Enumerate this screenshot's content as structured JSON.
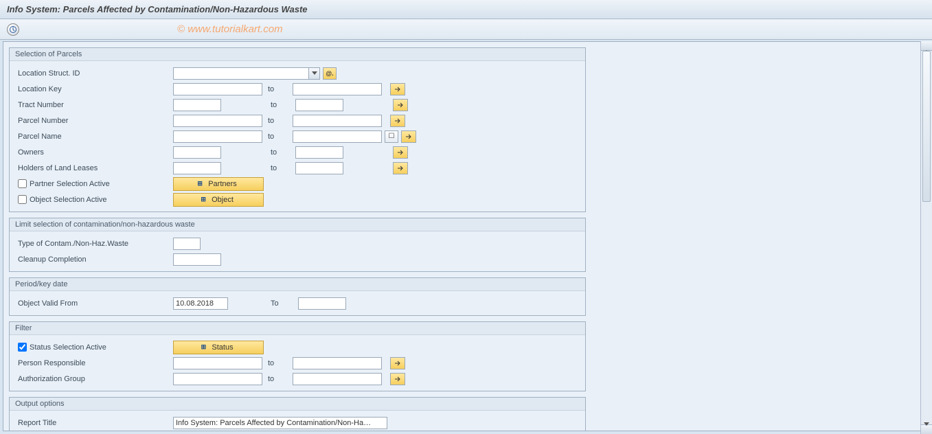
{
  "title": "Info System: Parcels Affected by Contamination/Non-Hazardous Waste",
  "watermark": "© www.tutorialkart.com",
  "labels": {
    "to": "to",
    "To": "To"
  },
  "groups": {
    "parcels": {
      "title": "Selection of Parcels",
      "loc_struct_id": "Location Struct. ID",
      "location_key": "Location Key",
      "tract_number": "Tract Number",
      "parcel_number": "Parcel Number",
      "parcel_name": "Parcel Name",
      "owners": "Owners",
      "holders": "Holders of Land Leases",
      "partner_sel": "Partner Selection Active",
      "object_sel": "Object Selection Active",
      "partners_btn": "Partners",
      "object_btn": "Object"
    },
    "contam": {
      "title": "Limit selection of contamination/non-hazardous waste",
      "type": "Type of Contam./Non-Haz.Waste",
      "cleanup": "Cleanup Completion"
    },
    "period": {
      "title": "Period/key date",
      "valid_from": "Object Valid From",
      "valid_from_value": "10.08.2018"
    },
    "filter": {
      "title": "Filter",
      "status_sel": "Status Selection Active",
      "status_btn": "Status",
      "person_resp": "Person Responsible",
      "auth_group": "Authorization Group"
    },
    "output": {
      "title": "Output options",
      "report_title": "Report Title",
      "report_title_value": "Info System: Parcels Affected by Contamination/Non-Ha…"
    }
  },
  "values": {
    "loc_struct_id": "",
    "location_key_from": "",
    "location_key_to": "",
    "tract_from": "",
    "tract_to": "",
    "parcel_num_from": "",
    "parcel_num_to": "",
    "parcel_name_from": "",
    "parcel_name_to": "",
    "owners_from": "",
    "owners_to": "",
    "holders_from": "",
    "holders_to": "",
    "partner_sel_checked": false,
    "object_sel_checked": false,
    "contam_type": "",
    "cleanup": "",
    "valid_to": "",
    "status_sel_checked": true,
    "person_resp_from": "",
    "person_resp_to": "",
    "auth_group_from": "",
    "auth_group_to": ""
  }
}
